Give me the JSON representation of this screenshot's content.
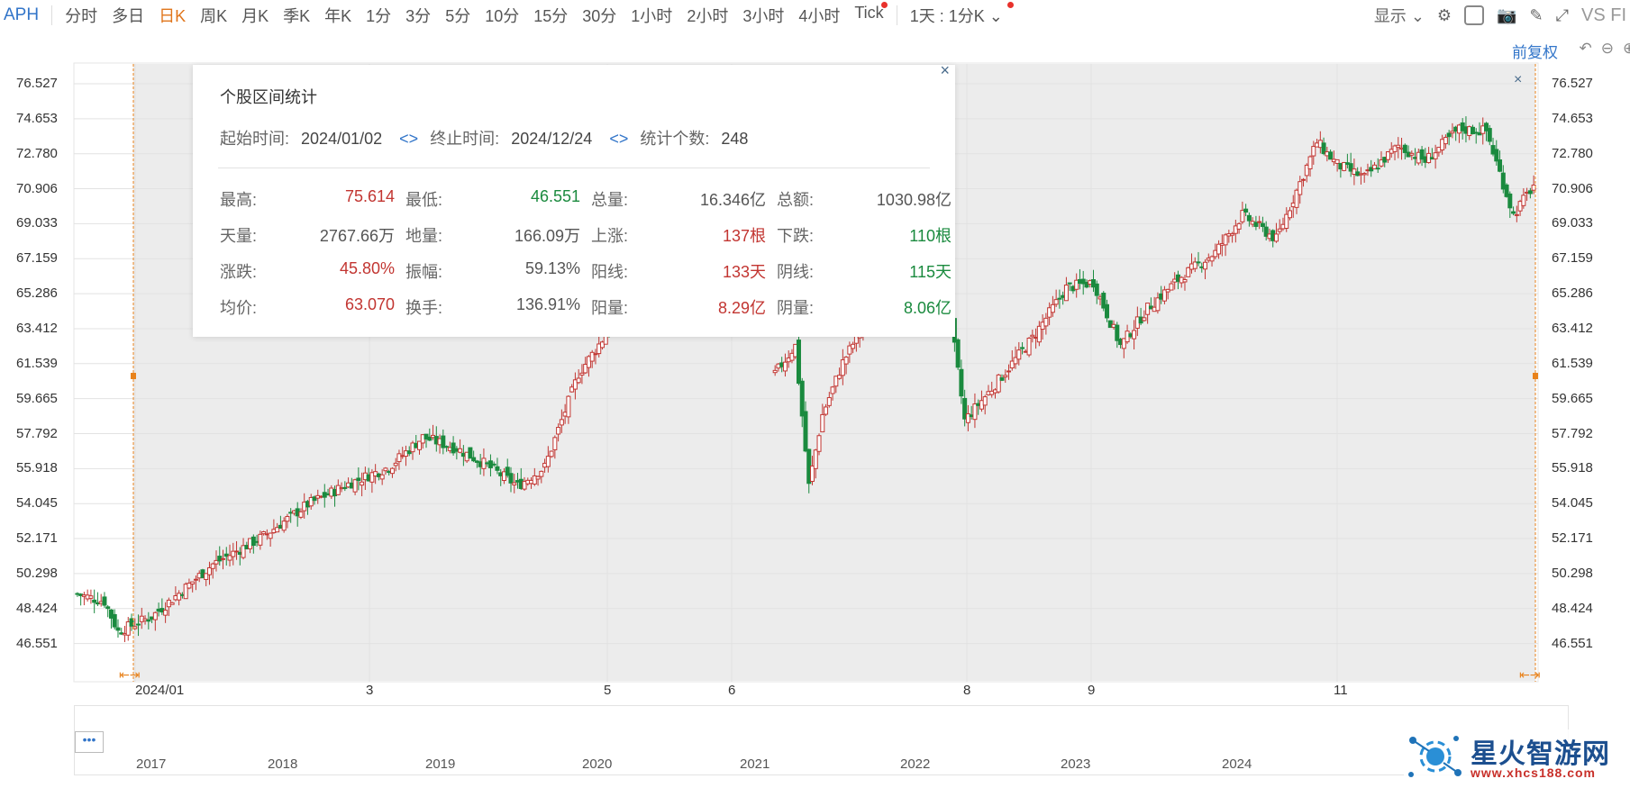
{
  "toolbar": {
    "symbol": "APH",
    "timeframes": [
      "分时",
      "多日",
      "日K",
      "周K",
      "月K",
      "季K",
      "年K",
      "1分",
      "3分",
      "5分",
      "10分",
      "15分",
      "30分",
      "1小时",
      "2小时",
      "3小时",
      "4小时",
      "Tick"
    ],
    "active_index": 2,
    "multi": "1天 : 1分K",
    "display": "显示",
    "vs": "VS FI"
  },
  "price_mode": "前复权",
  "chart_data": {
    "type": "candlestick",
    "y_ticks": [
      "76.527",
      "74.653",
      "72.780",
      "70.906",
      "69.033",
      "67.159",
      "65.286",
      "63.412",
      "61.539",
      "59.665",
      "57.792",
      "55.918",
      "54.045",
      "52.171",
      "50.298",
      "48.424",
      "46.551"
    ],
    "ylim": [
      46.551,
      76.527
    ],
    "x_ticks": [
      "2024/01",
      "3",
      "5",
      "6",
      "8",
      "9",
      "11"
    ],
    "selection": {
      "start": "2024/01/02",
      "end": "2024/12/24"
    },
    "colors": {
      "up": "#c23531",
      "down": "#1a8a3e",
      "selection_bg": "#ececec"
    },
    "grid": true,
    "close_path": [
      [
        0,
        49.2
      ],
      [
        8,
        48.8
      ],
      [
        12,
        47.2
      ],
      [
        22,
        48.0
      ],
      [
        40,
        50.8
      ],
      [
        55,
        52.3
      ],
      [
        68,
        54.0
      ],
      [
        80,
        55.1
      ],
      [
        92,
        56.0
      ],
      [
        102,
        57.6
      ],
      [
        112,
        57.0
      ],
      [
        120,
        56.2
      ],
      [
        130,
        55.0
      ],
      [
        138,
        56.0
      ],
      [
        148,
        61.0
      ],
      [
        158,
        63.6
      ],
      [
        170,
        63.8
      ],
      [
        182,
        64.5
      ],
      [
        196,
        64.0
      ],
      [
        206,
        61.0
      ],
      [
        212,
        62.5
      ],
      [
        216,
        55.0
      ],
      [
        220,
        58.8
      ],
      [
        226,
        61.6
      ],
      [
        238,
        65.6
      ],
      [
        248,
        66.9
      ],
      [
        256,
        66.3
      ],
      [
        262,
        58.5
      ],
      [
        270,
        60.2
      ],
      [
        282,
        62.9
      ],
      [
        292,
        65.6
      ],
      [
        300,
        65.9
      ],
      [
        308,
        62.5
      ],
      [
        316,
        64.5
      ],
      [
        326,
        66.2
      ],
      [
        336,
        67.5
      ],
      [
        344,
        69.5
      ],
      [
        354,
        68.2
      ],
      [
        366,
        73.4
      ],
      [
        372,
        72.2
      ],
      [
        380,
        71.5
      ],
      [
        390,
        73.2
      ],
      [
        398,
        72.4
      ],
      [
        408,
        74.1
      ],
      [
        416,
        74.0
      ],
      [
        424,
        69.5
      ],
      [
        430,
        71.1
      ]
    ],
    "navigator_years": [
      "2017",
      "2018",
      "2019",
      "2020",
      "2021",
      "2022",
      "2023",
      "2024"
    ]
  },
  "stats_panel": {
    "title": "个股区间统计",
    "start_label": "起始时间:",
    "start": "2024/01/02",
    "end_label": "终止时间:",
    "end": "2024/12/24",
    "count_label": "统计个数:",
    "count": "248",
    "rows": [
      [
        {
          "label": "最高:",
          "value": "75.614",
          "tone": "up"
        },
        {
          "label": "最低:",
          "value": "46.551",
          "tone": "dn"
        },
        {
          "label": "总量:",
          "value": "16.346亿",
          "tone": "neu"
        },
        {
          "label": "总额:",
          "value": "1030.98亿",
          "tone": "neu"
        }
      ],
      [
        {
          "label": "天量:",
          "value": "2767.66万",
          "tone": "neu"
        },
        {
          "label": "地量:",
          "value": "166.09万",
          "tone": "neu"
        },
        {
          "label": "上涨:",
          "value": "137根",
          "tone": "up"
        },
        {
          "label": "下跌:",
          "value": "110根",
          "tone": "dn"
        }
      ],
      [
        {
          "label": "涨跌:",
          "value": "45.80%",
          "tone": "up"
        },
        {
          "label": "振幅:",
          "value": "59.13%",
          "tone": "neu"
        },
        {
          "label": "阳线:",
          "value": "133天",
          "tone": "up"
        },
        {
          "label": "阴线:",
          "value": "115天",
          "tone": "dn"
        }
      ],
      [
        {
          "label": "均价:",
          "value": "63.070",
          "tone": "up"
        },
        {
          "label": "换手:",
          "value": "136.91%",
          "tone": "neu"
        },
        {
          "label": "阳量:",
          "value": "8.29亿",
          "tone": "up"
        },
        {
          "label": "阴量:",
          "value": "8.06亿",
          "tone": "dn"
        }
      ]
    ]
  },
  "watermark": {
    "name": "星火智游网",
    "url": "www.xhcs188.com"
  }
}
